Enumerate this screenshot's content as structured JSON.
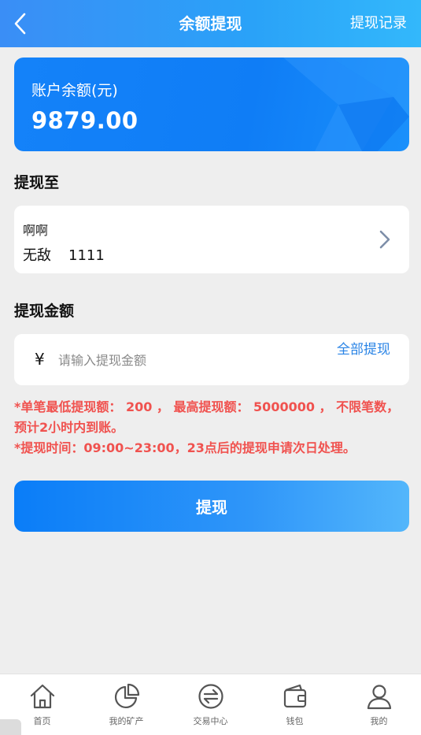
{
  "header": {
    "title": "余额提现",
    "records_label": "提现记录",
    "back_icon": "chevron-left-icon"
  },
  "balance": {
    "label": "账户余额(元)",
    "value": "9879.00"
  },
  "withdraw_to": {
    "title": "提现至",
    "account_name": "啊啊",
    "bank_name": "无敌",
    "card_number": "1111",
    "arrow_icon": "chevron-right-icon"
  },
  "amount": {
    "title": "提现金额",
    "currency_symbol": "¥",
    "input_value": "",
    "placeholder": "请输入提现金额",
    "withdraw_all_label": "全部提现"
  },
  "notice": {
    "line1": "*单笔最低提现额： 200 ， 最高提现额： 5000000 ， 不限笔数，预计2小时内到账。",
    "line2": "*提现时间：09:00~23:00，23点后的提现申请次日处理。"
  },
  "submit_label": "提现",
  "tabs": [
    {
      "label": "首页",
      "icon": "home-icon"
    },
    {
      "label": "我的矿产",
      "icon": "pie-chart-icon"
    },
    {
      "label": "交易中心",
      "icon": "exchange-icon"
    },
    {
      "label": "钱包",
      "icon": "wallet-icon"
    },
    {
      "label": "我的",
      "icon": "user-icon"
    }
  ],
  "colors": {
    "header_gradient_start": "#3a8ef6",
    "header_gradient_end": "#33b8fb",
    "card_blue": "#1482f9",
    "notice_red": "#f0524f",
    "link_blue": "#2a84e6",
    "page_bg": "#eeeeee"
  }
}
